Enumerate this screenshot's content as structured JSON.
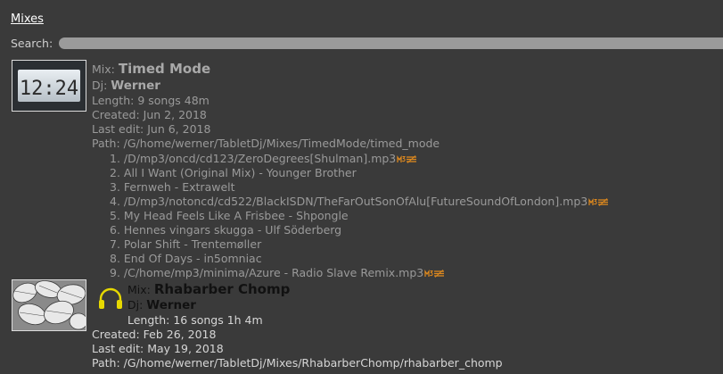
{
  "header": {
    "tab_label": "Mixes"
  },
  "search": {
    "label": "Search:",
    "value": ""
  },
  "mixes": [
    {
      "mix_label": "Mix:",
      "title": "Timed Mode",
      "dj_label": "Dj:",
      "dj": "Werner",
      "length_label": "Length:",
      "length": "9 songs 48m",
      "created_label": "Created:",
      "created": "Jun 2, 2018",
      "edited_label": "Last edit:",
      "edited": "Jun 6, 2018",
      "path_label": "Path:",
      "path": "/G/home/werner/TabletDj/Mixes/TimedMode/timed_mode",
      "thumbnail_text": "12:24",
      "songs": [
        {
          "text": "1. /D/mp3/oncd/cd123/ZeroDegrees[Shulman].mp3",
          "badges": true
        },
        {
          "text": "2. All I Want (Original Mix) - Younger Brother",
          "badges": false
        },
        {
          "text": "3. Fernweh - Extrawelt",
          "badges": false
        },
        {
          "text": "4. /D/mp3/notoncd/cd522/BlackISDN/TheFarOutSonOfAlu[FutureSoundOfLondon].mp3",
          "badges": true
        },
        {
          "text": "5. My Head Feels Like A Frisbee - Shpongle",
          "badges": false
        },
        {
          "text": "6. Hennes vingars skugga - Ulf Söderberg",
          "badges": false
        },
        {
          "text": "7. Polar Shift - Trentemøller",
          "badges": false
        },
        {
          "text": "8. End Of Days - in5omniac",
          "badges": false
        },
        {
          "text": "9. /C/home/mp3/minima/Azure - Radio Slave Remix.mp3",
          "badges": true
        }
      ]
    },
    {
      "mix_label": "Mix:",
      "title": "Rhabarber Chomp",
      "dj_label": "Dj:",
      "dj": "Werner",
      "length_label": "Length:",
      "length": "16 songs 1h 4m",
      "created_label": "Created:",
      "created": "Feb 26, 2018",
      "edited_label": "Last edit:",
      "edited": "May 19, 2018",
      "path_label": "Path:",
      "path": "/G/home/werner/TabletDj/Mixes/RhabarberChomp/rhabarber_chomp"
    }
  ],
  "colors": {
    "background": "#3a3a3a",
    "badge_orange": "#e08a1e",
    "headphones_yellow": "#e6d800"
  },
  "icons": {
    "playing": "headphones-icon",
    "file_badge": "mp3-icon",
    "warning_badge": "equalizer-icon"
  }
}
